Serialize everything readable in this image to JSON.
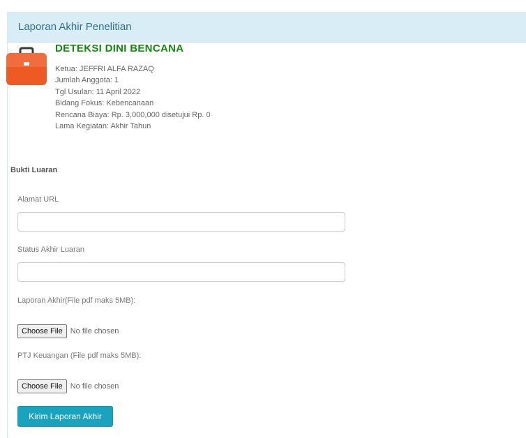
{
  "panel": {
    "title": "Laporan Akhir Penelitian"
  },
  "project": {
    "icon": "briefcase-icon",
    "title": "DETEKSI DINI BENCANA",
    "ketua": "Ketua: JEFFRI ALFA RAZAQ",
    "jumlah_anggota": "Jumlah Anggota: 1",
    "tgl_usulan": "Tgl Usulan: 11 April 2022",
    "bidang_fokus": "Bidang Fokus: Kebencanaan",
    "rencana_biaya": "Rencana Biaya: Rp. 3,000,000 disetujui Rp. 0",
    "lama_kegiatan": "Lama Kegiatan: Akhir Tahun"
  },
  "form": {
    "section_title": "Bukti Luaran",
    "url_label": "Alamat URL",
    "url_value": "",
    "status_label": "Status Akhir Luaran",
    "status_value": "",
    "laporan_label": "Laporan Akhir(File pdf maks 5MB):",
    "laporan_button": "Choose File",
    "laporan_status": "No file chosen",
    "ptj_label": "PTJ Keuangan (File pdf maks 5MB):",
    "ptj_button": "Choose File",
    "ptj_status": "No file chosen",
    "submit_label": "Kirim Laporan Akhir"
  },
  "colors": {
    "header_bg": "#d9edf7",
    "header_text": "#31708f",
    "project_title": "#0f8a0f",
    "briefcase": "#f05a28",
    "submit_bg": "#1aa3be"
  }
}
